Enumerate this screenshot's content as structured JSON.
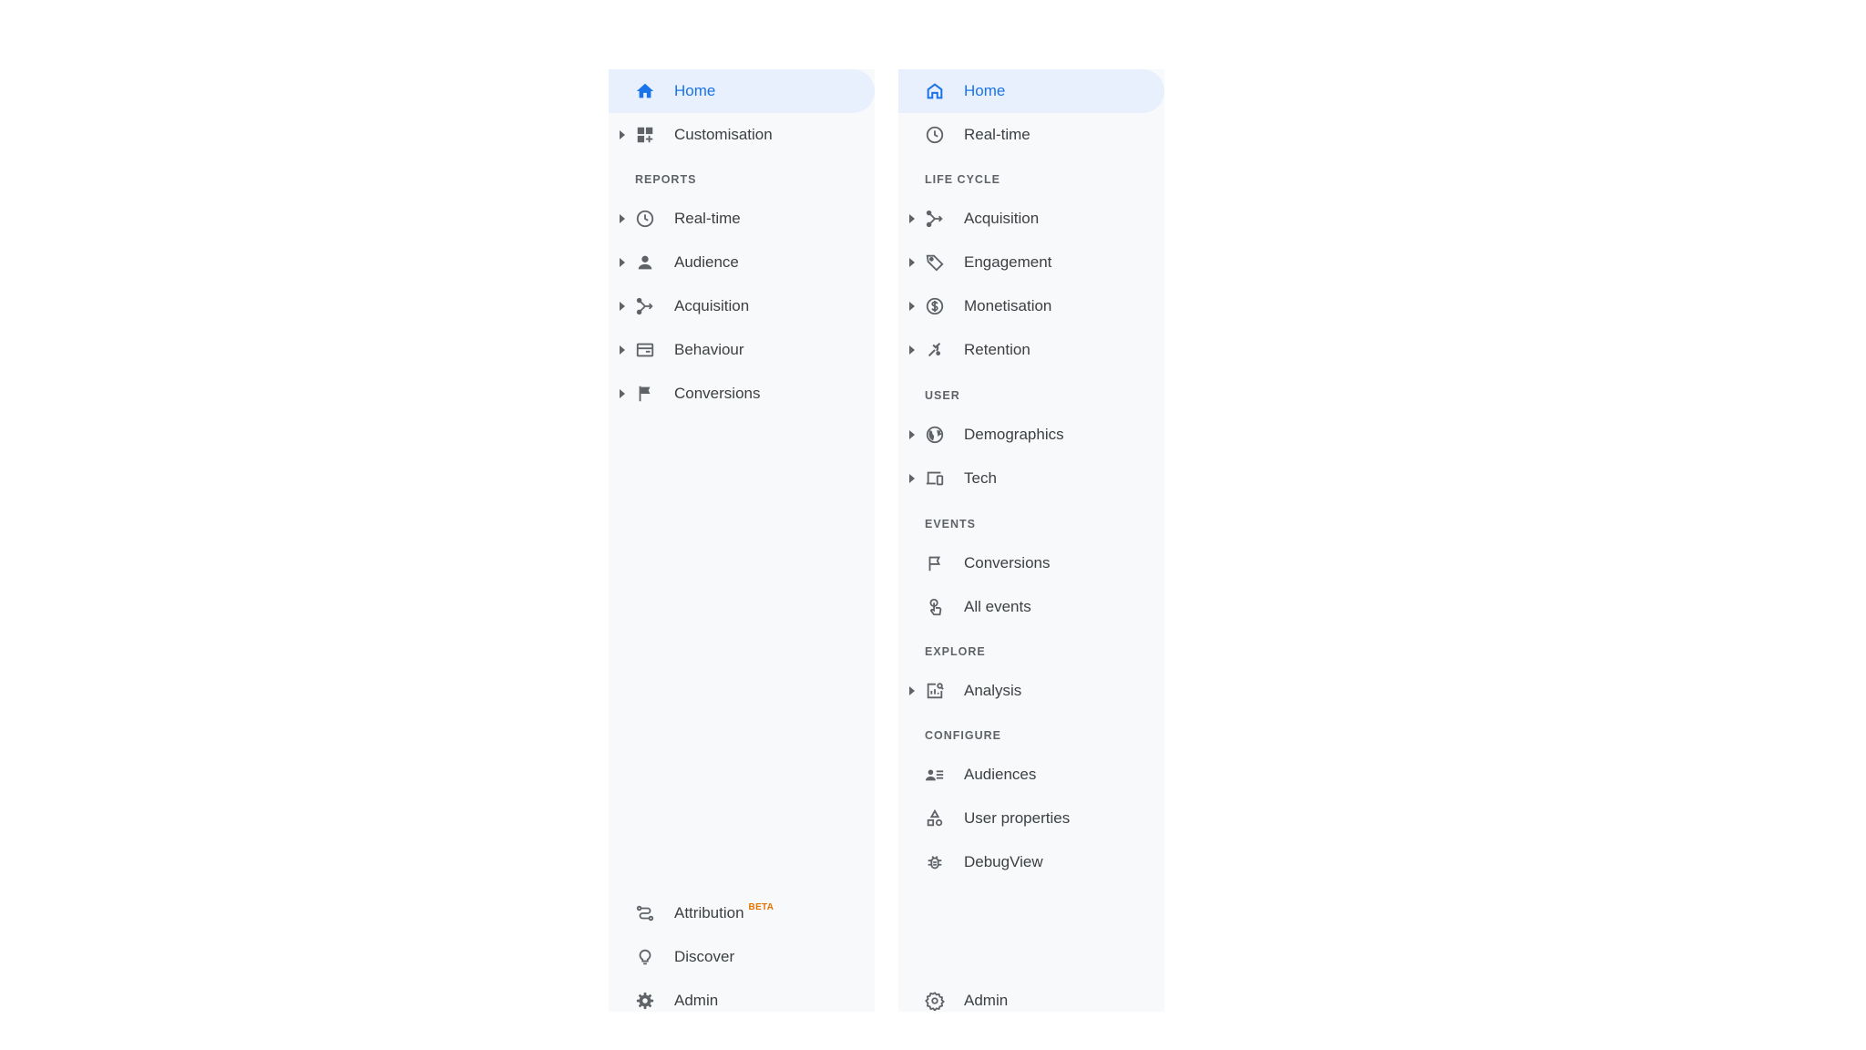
{
  "left": {
    "home": "Home",
    "customisation": "Customisation",
    "reports_header": "REPORTS",
    "realtime": "Real-time",
    "audience": "Audience",
    "acquisition": "Acquisition",
    "behaviour": "Behaviour",
    "conversions": "Conversions",
    "attribution": "Attribution",
    "attribution_badge": "BETA",
    "discover": "Discover",
    "admin": "Admin"
  },
  "right": {
    "home": "Home",
    "realtime": "Real-time",
    "lifecycle_header": "LIFE CYCLE",
    "acquisition": "Acquisition",
    "engagement": "Engagement",
    "monetisation": "Monetisation",
    "retention": "Retention",
    "user_header": "USER",
    "demographics": "Demographics",
    "tech": "Tech",
    "events_header": "EVENTS",
    "conversions": "Conversions",
    "all_events": "All events",
    "explore_header": "EXPLORE",
    "analysis": "Analysis",
    "configure_header": "CONFIGURE",
    "audiences": "Audiences",
    "user_properties": "User properties",
    "debugview": "DebugView",
    "admin": "Admin"
  },
  "colors": {
    "active_text": "#1a73e8",
    "active_background": "#e8f0fe",
    "panel_background": "#f8f9fa",
    "beta_badge": "#e37400"
  },
  "icons": {
    "left": [
      "home-icon",
      "dashboard-icon",
      "clock-icon",
      "person-icon",
      "merge-icon",
      "browser-window-icon",
      "flag-icon",
      "attribution-icon",
      "lightbulb-icon",
      "gear-icon"
    ],
    "right": [
      "home-outline-icon",
      "clock-icon",
      "merge-icon",
      "tag-icon",
      "dollar-circle-icon",
      "retention-icon",
      "globe-icon",
      "devices-icon",
      "flag-outline-icon",
      "touch-icon",
      "analysis-icon",
      "audiences-icon",
      "shapes-icon",
      "bug-icon",
      "gear-outline-icon"
    ]
  }
}
